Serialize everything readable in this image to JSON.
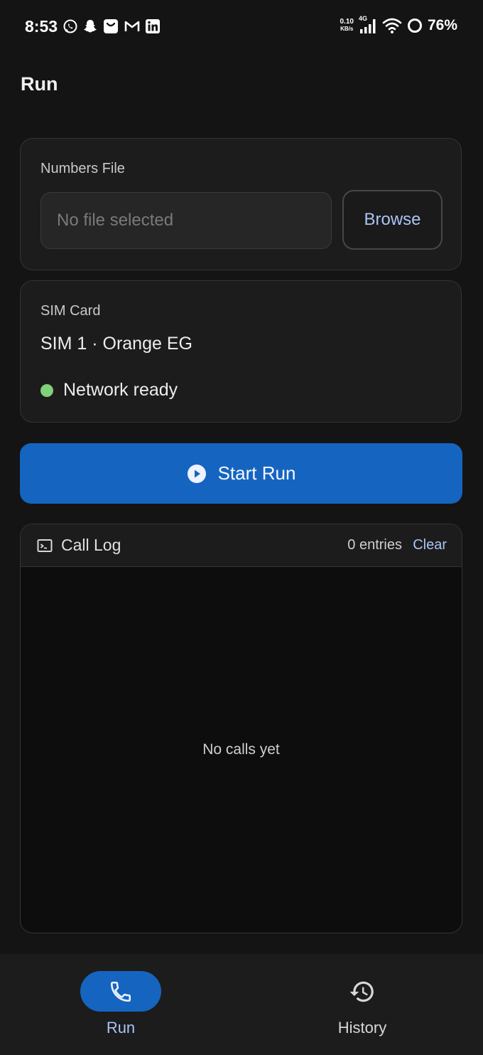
{
  "status_bar": {
    "time": "8:53",
    "net_speed_value": "0.10",
    "net_speed_unit": "KB/s",
    "network_type": "4G",
    "battery": "76%"
  },
  "page": {
    "title": "Run"
  },
  "numbers_file": {
    "label": "Numbers File",
    "placeholder": "No file selected",
    "browse_label": "Browse"
  },
  "sim_card": {
    "label": "SIM Card",
    "value": "SIM 1 · Orange EG",
    "network_status": "Network ready",
    "status_color": "#81d07a"
  },
  "start_button": {
    "label": "Start Run",
    "icon": "play-circle-icon"
  },
  "call_log": {
    "title": "Call Log",
    "icon": "terminal-icon",
    "count": "0 entries",
    "clear_label": "Clear",
    "empty_text": "No calls yet"
  },
  "bottom_nav": {
    "items": [
      {
        "label": "Run",
        "icon": "phone-icon",
        "active": true
      },
      {
        "label": "History",
        "icon": "history-icon",
        "active": false
      }
    ]
  },
  "colors": {
    "accent": "#1565c0",
    "link": "#a9c4f5",
    "background": "#141414",
    "card": "#1c1c1c"
  }
}
